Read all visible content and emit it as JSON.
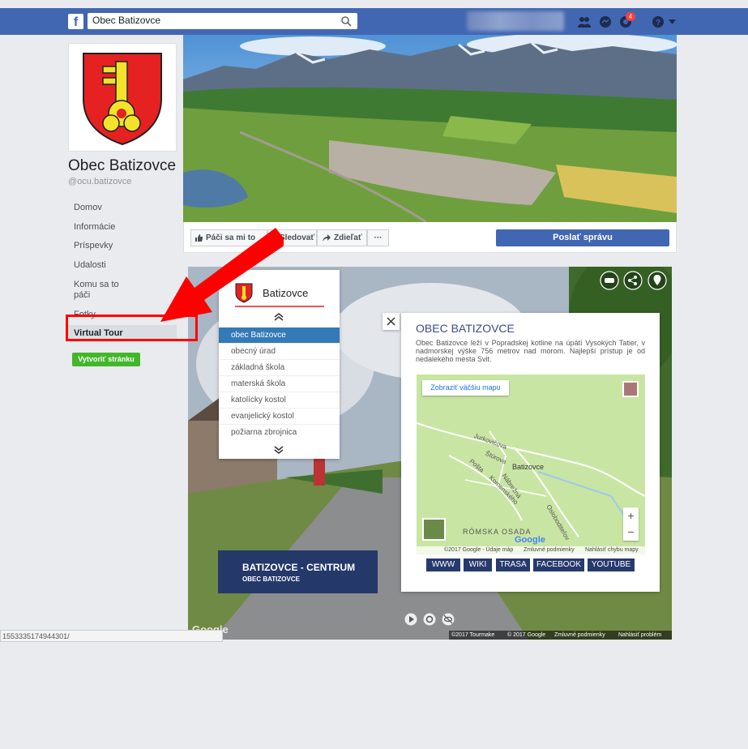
{
  "topbar": {
    "search_value": "Obec Batizovce",
    "notification_count": "4"
  },
  "page": {
    "name": "Obec Batizovce",
    "handle": "@ocu.batizovce"
  },
  "sidebar": {
    "items": [
      "Domov",
      "Informácie",
      "Príspevky",
      "Udalosti",
      "Komu sa to páči",
      "Fotky",
      "Virtual Tour"
    ],
    "create_page": "Vytvoriť stránku"
  },
  "actions": {
    "like": "Páči sa mi to",
    "follow": "Sledovať",
    "share": "Zdieľať",
    "more": "···",
    "send_message": "Poslať správu"
  },
  "tour": {
    "menu_title": "Batizovce",
    "menu_items": [
      "obec Batizovce",
      "obecný úrad",
      "základná škola",
      "materská škola",
      "katolícky kostol",
      "evanjelický kostol",
      "požiarna zbrojnica"
    ],
    "info_title": "OBEC BATIZOVCE",
    "info_text": "Obec Batizovce leží v Popradskej kotline na úpätí Vysokých Tatier, v nadmorskej výške 756 metrov nad morom. Najlepší prístup je od nedalekého mesta Svit.",
    "map_button": "Zobraziť väčšiu mapu",
    "map_labels": [
      "Jurkovičova",
      "Batizovce",
      "Štúrova",
      "Pošta",
      "Komenského",
      "Nábrežná",
      "Osloboditeľov",
      "RÓMSKA OSADA"
    ],
    "map_footer": [
      "©2017 Google - Údaje máp",
      "Zmluvné podmienky",
      "Nahlásiť chybu mapy"
    ],
    "links": [
      "WWW",
      "WIKI",
      "TRASA",
      "FACEBOOK",
      "YOUTUBE"
    ],
    "location_title": "BATIZOVCE - CENTRUM",
    "location_sub": "OBEC BATIZOVCE",
    "footer": [
      "©2017 Tourmake",
      "© 2017 Google",
      "Zmluvné podmienky",
      "Nahlásiť problém"
    ],
    "google": "Google"
  },
  "status_url": "1553335174944301/",
  "colors": {
    "facebook_blue": "#4267b2",
    "highlight_red": "#ff0000",
    "tour_navy": "#24386a",
    "active_menu": "#337ab7",
    "create_green": "#42b72a"
  }
}
